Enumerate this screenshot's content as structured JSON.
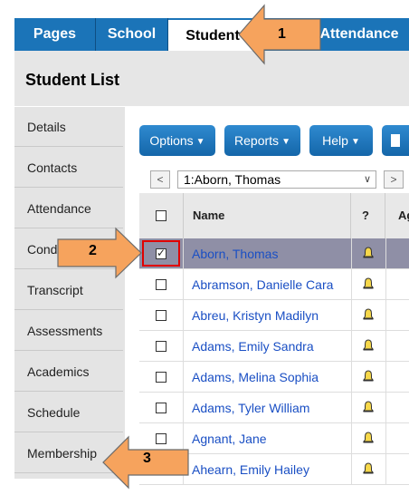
{
  "topnav": {
    "tabs": [
      "Pages",
      "School",
      "Student",
      "Attendance"
    ]
  },
  "page": {
    "title": "Student List"
  },
  "sidenav": {
    "items": [
      "Details",
      "Contacts",
      "Attendance",
      "Conduct",
      "Transcript",
      "Assessments",
      "Academics",
      "Schedule",
      "Membership"
    ]
  },
  "toolbar": {
    "options_label": "Options",
    "reports_label": "Reports",
    "help_label": "Help"
  },
  "record_nav": {
    "prev_label": "<",
    "next_label": ">",
    "current": "1:Aborn, Thomas"
  },
  "table": {
    "headers": [
      "Name",
      "?",
      "Ag"
    ],
    "rows": [
      {
        "name": "Aborn, Thomas",
        "checked": true
      },
      {
        "name": "Abramson, Danielle Cara",
        "checked": false
      },
      {
        "name": "Abreu, Kristyn Madilyn",
        "checked": false
      },
      {
        "name": "Adams, Emily Sandra",
        "checked": false
      },
      {
        "name": "Adams, Melina Sophia",
        "checked": false
      },
      {
        "name": "Adams, Tyler William",
        "checked": false
      },
      {
        "name": "Agnant, Jane",
        "checked": false
      },
      {
        "name": "Ahearn, Emily Hailey",
        "checked": false
      }
    ]
  },
  "callouts": [
    "1",
    "2",
    "3"
  ],
  "colors": {
    "brand_blue": "#1b74b8",
    "callout_orange": "#f6a35d",
    "selected_row": "#8f8fa6",
    "highlight_red": "#e00000"
  }
}
